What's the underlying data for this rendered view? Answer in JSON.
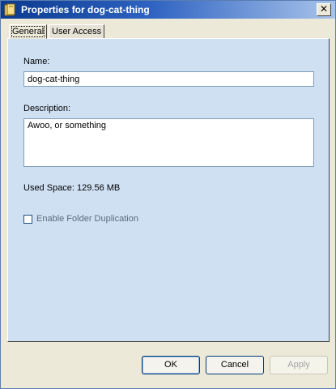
{
  "window": {
    "title": "Properties for dog-cat-thing",
    "close_glyph": "✕"
  },
  "tabs": [
    {
      "label": "General",
      "active": true
    },
    {
      "label": "User Access",
      "active": false
    }
  ],
  "form": {
    "name_label": "Name:",
    "name_value": "dog-cat-thing",
    "description_label": "Description:",
    "description_value": "Awoo, or something",
    "used_space": "Used Space: 129.56 MB",
    "folder_duplication_label": "Enable Folder Duplication",
    "folder_duplication_checked": false
  },
  "buttons": {
    "ok": "OK",
    "cancel": "Cancel",
    "apply": "Apply"
  },
  "colors": {
    "panel_background": "#cfe0f3",
    "title_gradient_start": "#0b3a8e"
  }
}
